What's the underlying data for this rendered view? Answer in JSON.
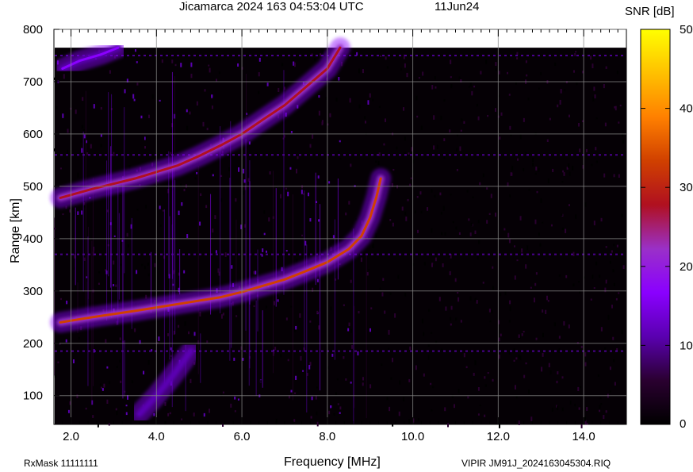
{
  "header": {
    "title": "Jicamarca 2024 163 04:53:04 UTC",
    "date": "11Jun24"
  },
  "footer": {
    "rx_mask": "RxMask 11111111",
    "file_info": "VIPIR  JM91J_2024163045304.RIQ"
  },
  "chart_data": {
    "type": "heatmap",
    "title": "Jicamarca 2024 163 04:53:04 UTC",
    "date": "11Jun24",
    "xlabel": "Frequency [MHz]",
    "ylabel": "Range [km]",
    "colorbar_label": "SNR [dB]",
    "xlim": [
      1.6,
      15.0
    ],
    "ylim": [
      45,
      800
    ],
    "data_ylim": [
      45,
      765
    ],
    "x_ticks": [
      "2.0",
      "4.0",
      "6.0",
      "8.0",
      "10.0",
      "12.0",
      "14.0"
    ],
    "x_tick_values": [
      2,
      4,
      6,
      8,
      10,
      12,
      14
    ],
    "y_ticks": [
      "100",
      "200",
      "300",
      "400",
      "500",
      "600",
      "700",
      "800"
    ],
    "y_tick_values": [
      100,
      200,
      300,
      400,
      500,
      600,
      700,
      800
    ],
    "colorbar_range": [
      0,
      50
    ],
    "colorbar_ticks": [
      "0",
      "10",
      "20",
      "30",
      "40",
      "50"
    ],
    "colorbar_tick_values": [
      0,
      10,
      20,
      30,
      40,
      50
    ],
    "grid": true,
    "colorscale": [
      "#000000",
      "#2a0030",
      "#5a00b0",
      "#8a00ff",
      "#9a30c8",
      "#b01020",
      "#d04000",
      "#ff8000",
      "#ffc000",
      "#ffff00"
    ],
    "traces": [
      {
        "name": "first-hop F-trace",
        "points": [
          [
            1.75,
            240
          ],
          [
            2.5,
            250
          ],
          [
            3.5,
            262
          ],
          [
            4.5,
            275
          ],
          [
            5.5,
            288
          ],
          [
            6.0,
            298
          ],
          [
            6.5,
            310
          ],
          [
            7.0,
            322
          ],
          [
            7.5,
            338
          ],
          [
            8.0,
            355
          ],
          [
            8.5,
            380
          ],
          [
            8.8,
            405
          ],
          [
            9.0,
            440
          ],
          [
            9.15,
            480
          ],
          [
            9.25,
            515
          ]
        ],
        "peak_snr": 33
      },
      {
        "name": "second-hop F-trace",
        "points": [
          [
            1.75,
            478
          ],
          [
            2.5,
            495
          ],
          [
            3.5,
            515
          ],
          [
            4.5,
            540
          ],
          [
            5.0,
            558
          ],
          [
            5.5,
            578
          ],
          [
            6.0,
            600
          ],
          [
            6.5,
            628
          ],
          [
            7.0,
            655
          ],
          [
            7.5,
            690
          ],
          [
            8.0,
            725
          ],
          [
            8.3,
            765
          ]
        ],
        "peak_snr": 30
      },
      {
        "name": "top faint trace",
        "points": [
          [
            1.8,
            725
          ],
          [
            2.2,
            740
          ],
          [
            2.7,
            752
          ],
          [
            3.1,
            765
          ]
        ],
        "peak_snr": 18
      },
      {
        "name": "low oblique trace",
        "points": [
          [
            3.6,
            65
          ],
          [
            4.0,
            100
          ],
          [
            4.4,
            140
          ],
          [
            4.8,
            185
          ]
        ],
        "peak_snr": 12
      }
    ],
    "interference_ranges_km": [
      185,
      370,
      560,
      750
    ]
  }
}
